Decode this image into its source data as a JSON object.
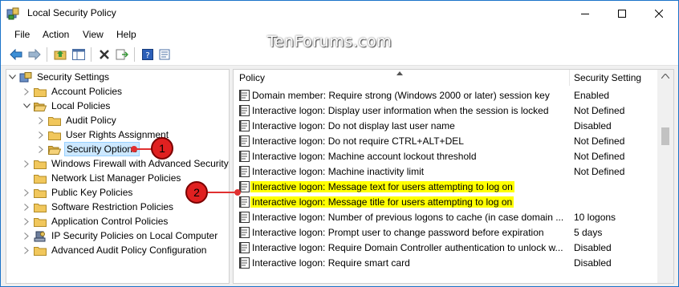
{
  "window": {
    "title": "Local Security Policy"
  },
  "watermark": "TenForums.com",
  "menu": [
    "File",
    "Action",
    "View",
    "Help"
  ],
  "toolbar": {
    "buttons": [
      "back-icon",
      "forward-icon",
      "up-folder-icon",
      "show-hide-tree-icon",
      "delete-icon",
      "export-list-icon",
      "help-icon",
      "properties-icon"
    ]
  },
  "tree": [
    {
      "label": "Security Settings",
      "level": 0,
      "expander": "expanded",
      "icon": "shield-icon",
      "selected": false
    },
    {
      "label": "Account Policies",
      "level": 1,
      "expander": "collapsed",
      "icon": "folder-icon",
      "selected": false
    },
    {
      "label": "Local Policies",
      "level": 1,
      "expander": "expanded",
      "icon": "folder-open-icon",
      "selected": false
    },
    {
      "label": "Audit Policy",
      "level": 2,
      "expander": "collapsed",
      "icon": "folder-icon",
      "selected": false
    },
    {
      "label": "User Rights Assignment",
      "level": 2,
      "expander": "collapsed",
      "icon": "folder-icon",
      "selected": false
    },
    {
      "label": "Security Options",
      "level": 2,
      "expander": "collapsed",
      "icon": "folder-open-icon",
      "selected": true
    },
    {
      "label": "Windows Firewall with Advanced Security",
      "level": 1,
      "expander": "collapsed",
      "icon": "folder-icon",
      "selected": false
    },
    {
      "label": "Network List Manager Policies",
      "level": 1,
      "expander": "none",
      "icon": "folder-icon",
      "selected": false
    },
    {
      "label": "Public Key Policies",
      "level": 1,
      "expander": "collapsed",
      "icon": "folder-icon",
      "selected": false
    },
    {
      "label": "Software Restriction Policies",
      "level": 1,
      "expander": "collapsed",
      "icon": "folder-icon",
      "selected": false
    },
    {
      "label": "Application Control Policies",
      "level": 1,
      "expander": "collapsed",
      "icon": "folder-icon",
      "selected": false
    },
    {
      "label": "IP Security Policies on Local Computer",
      "level": 1,
      "expander": "collapsed",
      "icon": "ip-security-icon",
      "selected": false
    },
    {
      "label": "Advanced Audit Policy Configuration",
      "level": 1,
      "expander": "collapsed",
      "icon": "folder-icon",
      "selected": false
    }
  ],
  "list": {
    "columns": {
      "policy": "Policy",
      "setting": "Security Setting"
    },
    "rows": [
      {
        "policy": "Domain member: Require strong (Windows 2000 or later) session key",
        "setting": "Enabled",
        "highlight": false
      },
      {
        "policy": "Interactive logon: Display user information when the session is locked",
        "setting": "Not Defined",
        "highlight": false
      },
      {
        "policy": "Interactive logon: Do not display last user name",
        "setting": "Disabled",
        "highlight": false
      },
      {
        "policy": "Interactive logon: Do not require CTRL+ALT+DEL",
        "setting": "Not Defined",
        "highlight": false
      },
      {
        "policy": "Interactive logon: Machine account lockout threshold",
        "setting": "Not Defined",
        "highlight": false
      },
      {
        "policy": "Interactive logon: Machine inactivity limit",
        "setting": "Not Defined",
        "highlight": false
      },
      {
        "policy": "Interactive logon: Message text for users attempting to log on",
        "setting": "",
        "highlight": true
      },
      {
        "policy": "Interactive logon: Message title for users attempting to log on",
        "setting": "",
        "highlight": true
      },
      {
        "policy": "Interactive logon: Number of previous logons to cache (in case domain ...",
        "setting": "10 logons",
        "highlight": false
      },
      {
        "policy": "Interactive logon: Prompt user to change password before expiration",
        "setting": "5 days",
        "highlight": false
      },
      {
        "policy": "Interactive logon: Require Domain Controller authentication to unlock w...",
        "setting": "Disabled",
        "highlight": false
      },
      {
        "policy": "Interactive logon: Require smart card",
        "setting": "Disabled",
        "highlight": false
      }
    ]
  },
  "callouts": [
    "1",
    "2"
  ],
  "colors": {
    "highlight": "#ffff00",
    "callout": "#e02020",
    "selection": "#cce8ff"
  }
}
